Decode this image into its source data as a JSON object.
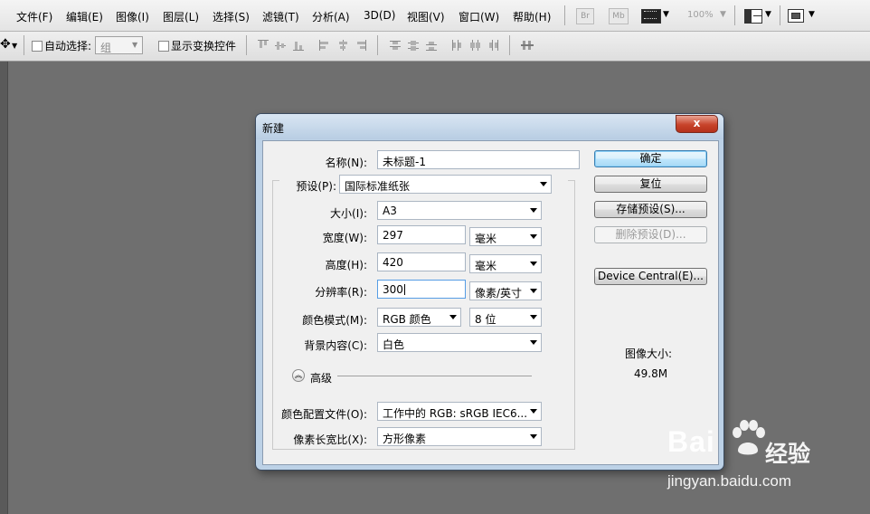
{
  "menu": [
    "文件(F)",
    "编辑(E)",
    "图像(I)",
    "图层(L)",
    "选择(S)",
    "滤镜(T)",
    "分析(A)",
    "3D(D)",
    "视图(V)",
    "窗口(W)",
    "帮助(H)"
  ],
  "appbar": {
    "bridge_label": "Br",
    "minibridge_label": "Mb",
    "zoom": "100%"
  },
  "options": {
    "auto_select_label": "自动选择:",
    "auto_select_value": "组",
    "show_transform_label": "显示变换控件"
  },
  "dialog": {
    "title": "新建",
    "close_label": "x",
    "fields": {
      "name_label": "名称(N):",
      "name_value": "未标题-1",
      "preset_label": "预设(P):",
      "preset_value": "国际标准纸张",
      "size_label": "大小(I):",
      "size_value": "A3",
      "width_label": "宽度(W):",
      "width_value": "297",
      "width_unit": "毫米",
      "height_label": "高度(H):",
      "height_value": "420",
      "height_unit": "毫米",
      "resolution_label": "分辨率(R):",
      "resolution_value": "300",
      "resolution_unit": "像素/英寸",
      "color_mode_label": "颜色模式(M):",
      "color_mode_value": "RGB 颜色",
      "bit_depth": "8 位",
      "background_label": "背景内容(C):",
      "background_value": "白色",
      "advanced_label": "高级",
      "profile_label": "颜色配置文件(O):",
      "profile_value": "工作中的 RGB: sRGB IEC6...",
      "aspect_label": "像素长宽比(X):",
      "aspect_value": "方形像素"
    },
    "buttons": {
      "ok": "确定",
      "reset": "复位",
      "save_preset": "存储预设(S)...",
      "delete_preset": "删除预设(D)...",
      "device_central": "Device Central(E)..."
    },
    "image_size_label": "图像大小:",
    "image_size_value": "49.8M"
  },
  "watermark": {
    "logo": "Bai",
    "logo2": "经验",
    "url": "jingyan.baidu.com"
  },
  "icons": [
    "move-tool-icon",
    "screen-mode-icon",
    "arrange-documents-icon",
    "align-icons",
    "paw-icon"
  ]
}
